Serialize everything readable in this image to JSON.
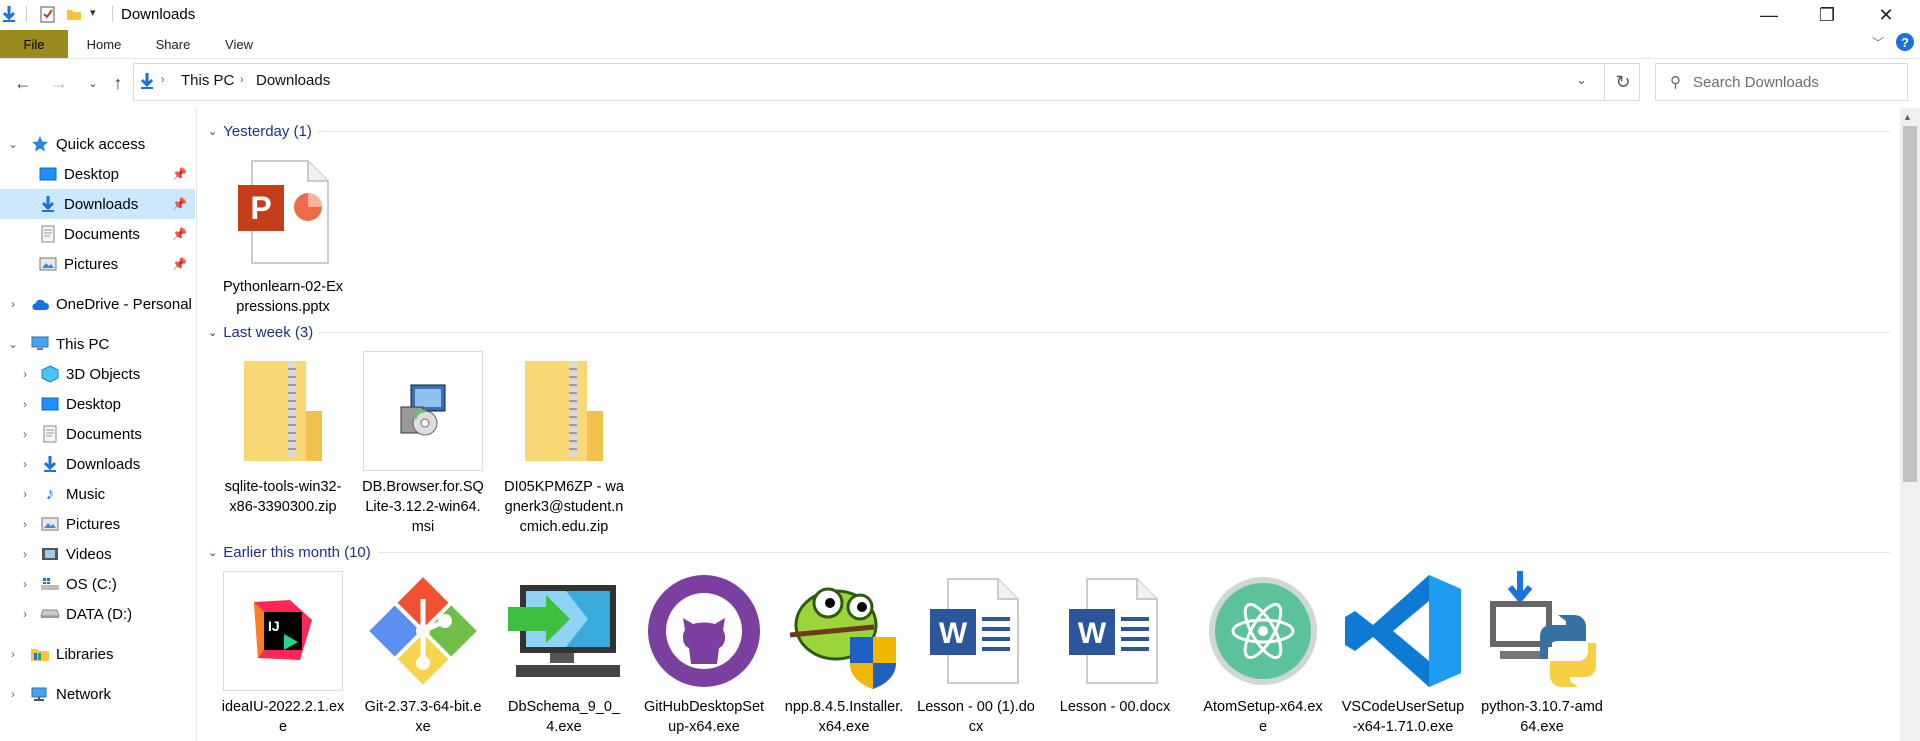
{
  "window": {
    "title": "Downloads",
    "minimize": "—",
    "maximize": "❐",
    "close": "✕",
    "help": "?"
  },
  "ribbon": {
    "tabs": [
      "File",
      "Home",
      "Share",
      "View"
    ]
  },
  "nav": {
    "breadcrumb": [
      "This PC",
      "Downloads"
    ],
    "search_placeholder": "Search Downloads"
  },
  "sidebar": {
    "quick_access": {
      "label": "Quick access",
      "items": [
        "Desktop",
        "Downloads",
        "Documents",
        "Pictures"
      ]
    },
    "onedrive": "OneDrive - Personal",
    "this_pc": {
      "label": "This PC",
      "items": [
        "3D Objects",
        "Desktop",
        "Documents",
        "Downloads",
        "Music",
        "Pictures",
        "Videos",
        "OS (C:)",
        "DATA (D:)"
      ]
    },
    "libraries": "Libraries",
    "network": "Network"
  },
  "groups": {
    "yesterday": {
      "header": "Yesterday (1)",
      "files": [
        "Pythonlearn-02-Expressions.pptx"
      ]
    },
    "last_week": {
      "header": "Last week (3)",
      "files": [
        "sqlite-tools-win32-x86-3390300.zip",
        "DB.Browser.for.SQLite-3.12.2-win64.msi",
        "DI05KPM6ZP - wagnerk3@student.ncmich.edu.zip"
      ]
    },
    "earlier": {
      "header": "Earlier this month (10)",
      "files": [
        "ideaIU-2022.2.1.exe",
        "Git-2.37.3-64-bit.exe",
        "DbSchema_9_0_4.exe",
        "GitHubDesktopSetup-x64.exe",
        "npp.8.4.5.Installer.x64.exe",
        "Lesson - 00 (1).docx",
        "Lesson - 00.docx",
        "AtomSetup-x64.exe",
        "VSCodeUserSetup-x64-1.71.0.exe",
        "python-3.10.7-amd64.exe"
      ]
    }
  }
}
